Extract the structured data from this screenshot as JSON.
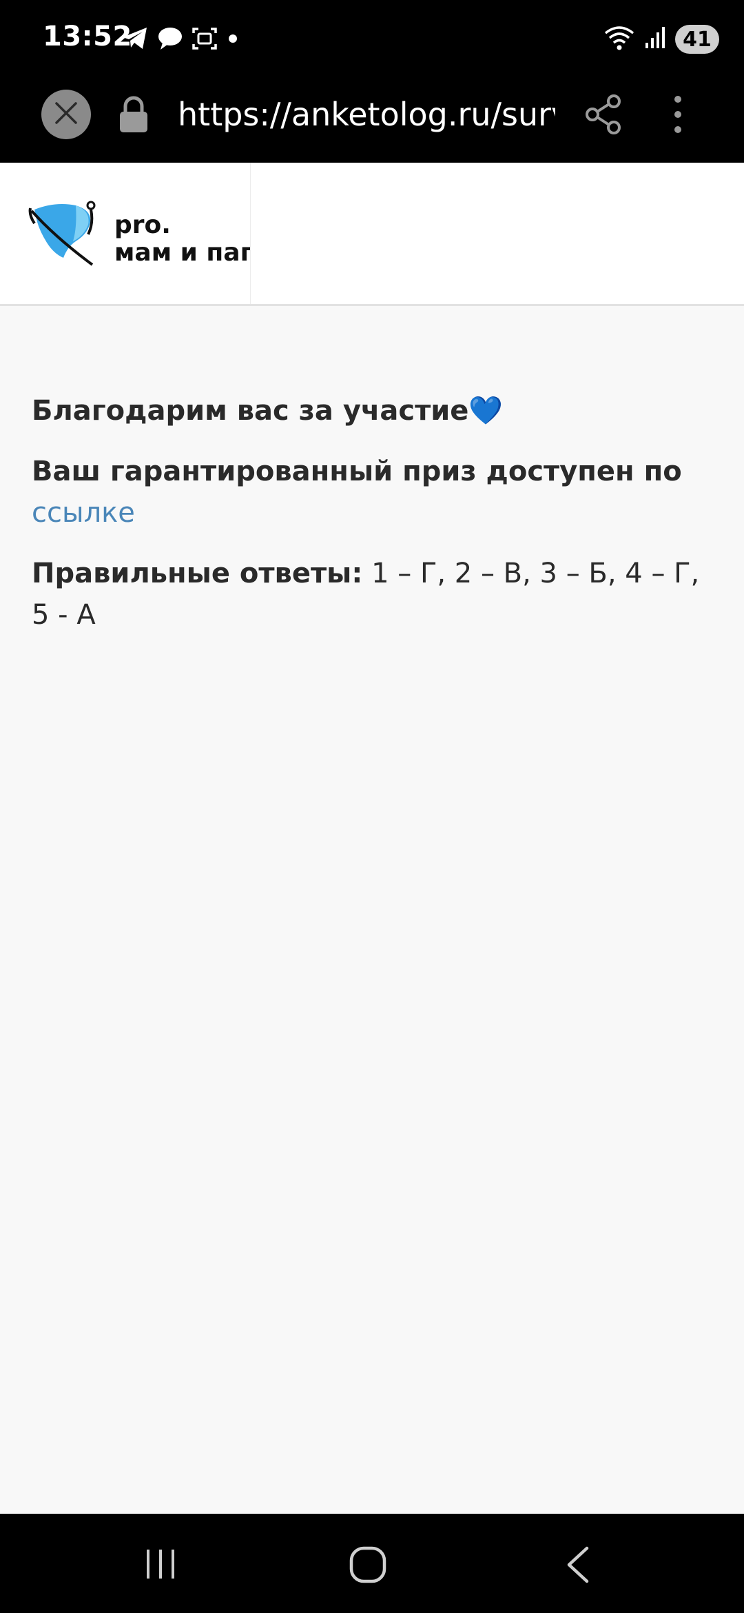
{
  "status_bar": {
    "time": "13:52",
    "left_icons": [
      "telegram-icon",
      "chat-bubble-icon",
      "screenshot-icon",
      "dot-icon"
    ],
    "right_icons": [
      "wifi-icon",
      "signal-icon"
    ],
    "battery_level": "41"
  },
  "browser": {
    "url": "https://anketolog.ru/survey",
    "icons": [
      "close-icon",
      "lock-icon",
      "share-icon",
      "more-icon"
    ]
  },
  "header": {
    "logo_line1": "pro.",
    "logo_line2": "мам и пап",
    "logo_colors": {
      "primary": "#3aa7e8",
      "light": "#7fd0f5"
    }
  },
  "content": {
    "thanks": "Благодарим вас за участие💙",
    "prize_text": "Ваш гарантированный приз доступен по ",
    "prize_link": "ссылке",
    "answers_label": "Правильные ответы:",
    "answers_value": " 1 – Г, 2 – В, 3 – Б, 4 – Г, 5 - А"
  },
  "colors": {
    "link": "#4a86b8",
    "text": "#2a2a2a",
    "page_background": "#f8f8f8"
  },
  "nav_bar": {
    "icons": [
      "recents-icon",
      "home-icon",
      "back-icon"
    ]
  }
}
